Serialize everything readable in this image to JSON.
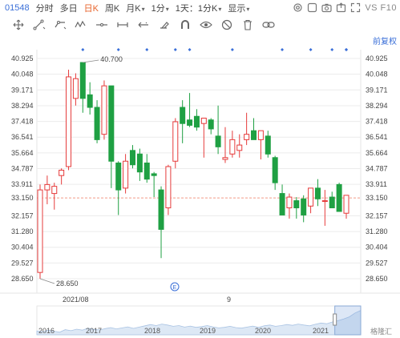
{
  "toolbar": {
    "code": "01548",
    "periods": [
      {
        "label": "分时",
        "active": false,
        "dropdown": false
      },
      {
        "label": "多日",
        "active": false,
        "dropdown": false
      },
      {
        "label": "日K",
        "active": true,
        "dropdown": false
      },
      {
        "label": "周K",
        "active": false,
        "dropdown": false
      },
      {
        "label": "月K",
        "active": false,
        "dropdown": true
      },
      {
        "label": "1分",
        "active": false,
        "dropdown": true
      },
      {
        "label": "1天：1分K",
        "active": false,
        "dropdown": true
      },
      {
        "label": "显示",
        "active": false,
        "dropdown": true
      }
    ],
    "right_icons": [
      "settings-icon",
      "square-icon",
      "camera-icon",
      "export-icon",
      "expand-icon"
    ],
    "vs_label": "VS F10"
  },
  "draw_tools": [
    "move-icon",
    "line-tool-icon",
    "ray-tool-icon",
    "wave-tool-icon",
    "horizontal-line-icon",
    "vertical-line-icon",
    "arrow-left-right-icon",
    "eraser-icon",
    "magnet-icon",
    "eye-icon",
    "no-entry-icon",
    "delete-icon",
    "link-icon"
  ],
  "adjust_label": "前复权",
  "chart_data": {
    "type": "candlestick",
    "y_ticks": [
      "40.925",
      "40.048",
      "39.171",
      "38.294",
      "37.418",
      "36.541",
      "35.664",
      "34.787",
      "33.911",
      "33.150",
      "32.157",
      "31.280",
      "30.404",
      "29.527",
      "28.650"
    ],
    "ylim": [
      28.65,
      40.925
    ],
    "current_price": 33.15,
    "max_label": "40.700",
    "min_label": "28.650",
    "x_labels": [
      "2021/08",
      "9"
    ],
    "candles": [
      {
        "o": 29.0,
        "h": 33.9,
        "l": 28.65,
        "c": 33.6
      },
      {
        "o": 33.6,
        "h": 34.4,
        "l": 32.8,
        "c": 33.9
      },
      {
        "o": 33.4,
        "h": 34.0,
        "l": 32.5,
        "c": 33.8
      },
      {
        "o": 34.4,
        "h": 34.8,
        "l": 33.9,
        "c": 34.7
      },
      {
        "o": 34.9,
        "h": 40.3,
        "l": 34.7,
        "c": 39.9
      },
      {
        "o": 38.7,
        "h": 40.1,
        "l": 38.3,
        "c": 39.8
      },
      {
        "o": 40.7,
        "h": 40.7,
        "l": 37.9,
        "c": 38.7
      },
      {
        "o": 38.9,
        "h": 39.6,
        "l": 37.8,
        "c": 38.2
      },
      {
        "o": 38.2,
        "h": 38.6,
        "l": 36.2,
        "c": 36.4
      },
      {
        "o": 36.7,
        "h": 39.7,
        "l": 36.4,
        "c": 39.4
      },
      {
        "o": 39.4,
        "h": 39.4,
        "l": 33.7,
        "c": 35.2
      },
      {
        "o": 35.1,
        "h": 35.2,
        "l": 32.2,
        "c": 33.6
      },
      {
        "o": 33.7,
        "h": 35.6,
        "l": 33.4,
        "c": 35.2
      },
      {
        "o": 35.8,
        "h": 36.1,
        "l": 34.8,
        "c": 35.0
      },
      {
        "o": 35.6,
        "h": 35.9,
        "l": 34.1,
        "c": 34.6
      },
      {
        "o": 35.1,
        "h": 35.6,
        "l": 34.0,
        "c": 34.2
      },
      {
        "o": 34.5,
        "h": 34.6,
        "l": 33.2,
        "c": 34.4
      },
      {
        "o": 33.6,
        "h": 33.8,
        "l": 29.8,
        "c": 31.4
      },
      {
        "o": 32.6,
        "h": 35.0,
        "l": 32.2,
        "c": 34.9
      },
      {
        "o": 35.2,
        "h": 37.6,
        "l": 34.8,
        "c": 37.4
      },
      {
        "o": 38.2,
        "h": 38.6,
        "l": 36.2,
        "c": 37.3
      },
      {
        "o": 37.5,
        "h": 39.0,
        "l": 37.1,
        "c": 37.2
      },
      {
        "o": 37.7,
        "h": 38.1,
        "l": 36.9,
        "c": 37.1
      },
      {
        "o": 37.3,
        "h": 37.6,
        "l": 35.4,
        "c": 37.6
      },
      {
        "o": 37.5,
        "h": 37.6,
        "l": 36.7,
        "c": 37.0
      },
      {
        "o": 36.6,
        "h": 38.3,
        "l": 35.6,
        "c": 36.0
      },
      {
        "o": 35.3,
        "h": 37.1,
        "l": 35.1,
        "c": 35.4
      },
      {
        "o": 35.6,
        "h": 36.9,
        "l": 35.4,
        "c": 36.4
      },
      {
        "o": 35.8,
        "h": 36.7,
        "l": 35.4,
        "c": 36.1
      },
      {
        "o": 36.4,
        "h": 37.9,
        "l": 36.1,
        "c": 36.7
      },
      {
        "o": 36.9,
        "h": 37.6,
        "l": 36.6,
        "c": 36.4
      },
      {
        "o": 36.4,
        "h": 36.9,
        "l": 35.3,
        "c": 36.9
      },
      {
        "o": 36.6,
        "h": 36.9,
        "l": 35.4,
        "c": 35.6
      },
      {
        "o": 35.4,
        "h": 35.5,
        "l": 33.6,
        "c": 34.0
      },
      {
        "o": 33.4,
        "h": 33.9,
        "l": 32.2,
        "c": 32.2
      },
      {
        "o": 32.6,
        "h": 33.4,
        "l": 32.0,
        "c": 33.2
      },
      {
        "o": 33.0,
        "h": 33.2,
        "l": 32.0,
        "c": 32.6
      },
      {
        "o": 33.1,
        "h": 33.3,
        "l": 31.8,
        "c": 32.2
      },
      {
        "o": 32.7,
        "h": 33.7,
        "l": 32.3,
        "c": 33.7
      },
      {
        "o": 33.7,
        "h": 34.2,
        "l": 32.7,
        "c": 33.1
      },
      {
        "o": 33.0,
        "h": 33.6,
        "l": 31.6,
        "c": 33.0
      },
      {
        "o": 33.2,
        "h": 33.5,
        "l": 32.6,
        "c": 32.6
      },
      {
        "o": 33.9,
        "h": 34.0,
        "l": 32.6,
        "c": 32.4
      },
      {
        "o": 32.3,
        "h": 33.3,
        "l": 32.0,
        "c": 33.3
      }
    ],
    "navigator": {
      "years": [
        "2016",
        "2017",
        "2018",
        "2019",
        "2020",
        "2021"
      ],
      "points": [
        0.15,
        0.12,
        0.18,
        0.14,
        0.1,
        0.2,
        0.16,
        0.22,
        0.18,
        0.26,
        0.21,
        0.19,
        0.24,
        0.28,
        0.23,
        0.27,
        0.31,
        0.25,
        0.3,
        0.35,
        0.4,
        0.36,
        0.42,
        0.38,
        0.33,
        0.36,
        0.3,
        0.34,
        0.29,
        0.32,
        0.36,
        0.31,
        0.27,
        0.29,
        0.33,
        0.28,
        0.26,
        0.3,
        0.34,
        0.29,
        0.35,
        0.38,
        0.33,
        0.36,
        0.4,
        0.37,
        0.42,
        0.38,
        0.35,
        0.41,
        0.46,
        0.43,
        0.5,
        0.55,
        0.62,
        0.7,
        0.85,
        0.95
      ],
      "handle_start": 0.92,
      "handle_end": 1.0
    },
    "marker_count": 11
  },
  "colors": {
    "up": "#e63b3b",
    "down": "#1fa043",
    "accent": "#e8642c",
    "blue": "#3a6fd8",
    "grid": "#ececec",
    "price_line": "#f29b88"
  },
  "watermark": "格隆汇"
}
